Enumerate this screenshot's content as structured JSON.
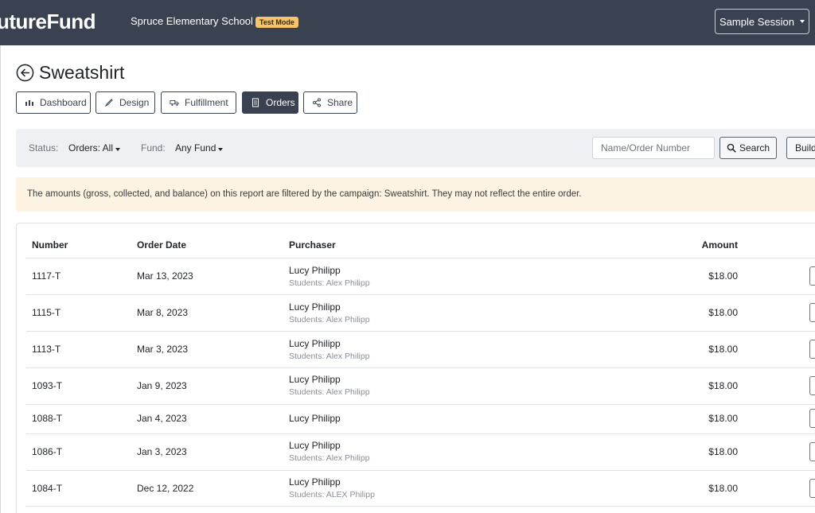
{
  "header": {
    "logo": "utureFund",
    "school": "Spruce Elementary School",
    "badge": "Test Mode",
    "session_label": "Sample Session"
  },
  "page": {
    "title": "Sweatshirt"
  },
  "nav": {
    "dashboard": "Dashboard",
    "design": "Design",
    "fulfillment": "Fulfillment",
    "orders": "Orders",
    "share": "Share"
  },
  "filters": {
    "status_label": "Status:",
    "status_value": "Orders: All",
    "fund_label": "Fund:",
    "fund_value": "Any Fund",
    "search_placeholder": "Name/Order Number",
    "search_button": "Search",
    "build_button": "Build"
  },
  "notice": "The amounts (gross, collected, and balance) on this report are filtered by the campaign: Sweatshirt. They may not reflect the entire order.",
  "table": {
    "headers": {
      "number": "Number",
      "date": "Order Date",
      "purchaser": "Purchaser",
      "amount": "Amount"
    },
    "rows": [
      {
        "number": "1117-T",
        "date": "Mar 13, 2023",
        "purchaser": "Lucy Philipp",
        "students": "Students: Alex Philipp",
        "amount": "$18.00"
      },
      {
        "number": "1115-T",
        "date": "Mar 8, 2023",
        "purchaser": "Lucy Philipp",
        "students": "Students: Alex Philipp",
        "amount": "$18.00"
      },
      {
        "number": "1113-T",
        "date": "Mar 3, 2023",
        "purchaser": "Lucy Philipp",
        "students": "Students: Alex Philipp",
        "amount": "$18.00"
      },
      {
        "number": "1093-T",
        "date": "Jan 9, 2023",
        "purchaser": "Lucy Philipp",
        "students": "Students: Alex Philipp",
        "amount": "$18.00"
      },
      {
        "number": "1088-T",
        "date": "Jan 4, 2023",
        "purchaser": "Lucy Philipp",
        "students": "",
        "amount": "$18.00"
      },
      {
        "number": "1086-T",
        "date": "Jan 3, 2023",
        "purchaser": "Lucy Philipp",
        "students": "Students: Alex Philipp",
        "amount": "$18.00"
      },
      {
        "number": "1084-T",
        "date": "Dec 12, 2022",
        "purchaser": "Lucy Philipp",
        "students": "Students: ALEX Philipp",
        "amount": "$18.00"
      }
    ]
  },
  "colors": {
    "header_bg": "#3a4150",
    "badge_bg": "#f7c46c",
    "notice_bg": "#fcf3e3",
    "filter_bg": "#eef0f3"
  }
}
